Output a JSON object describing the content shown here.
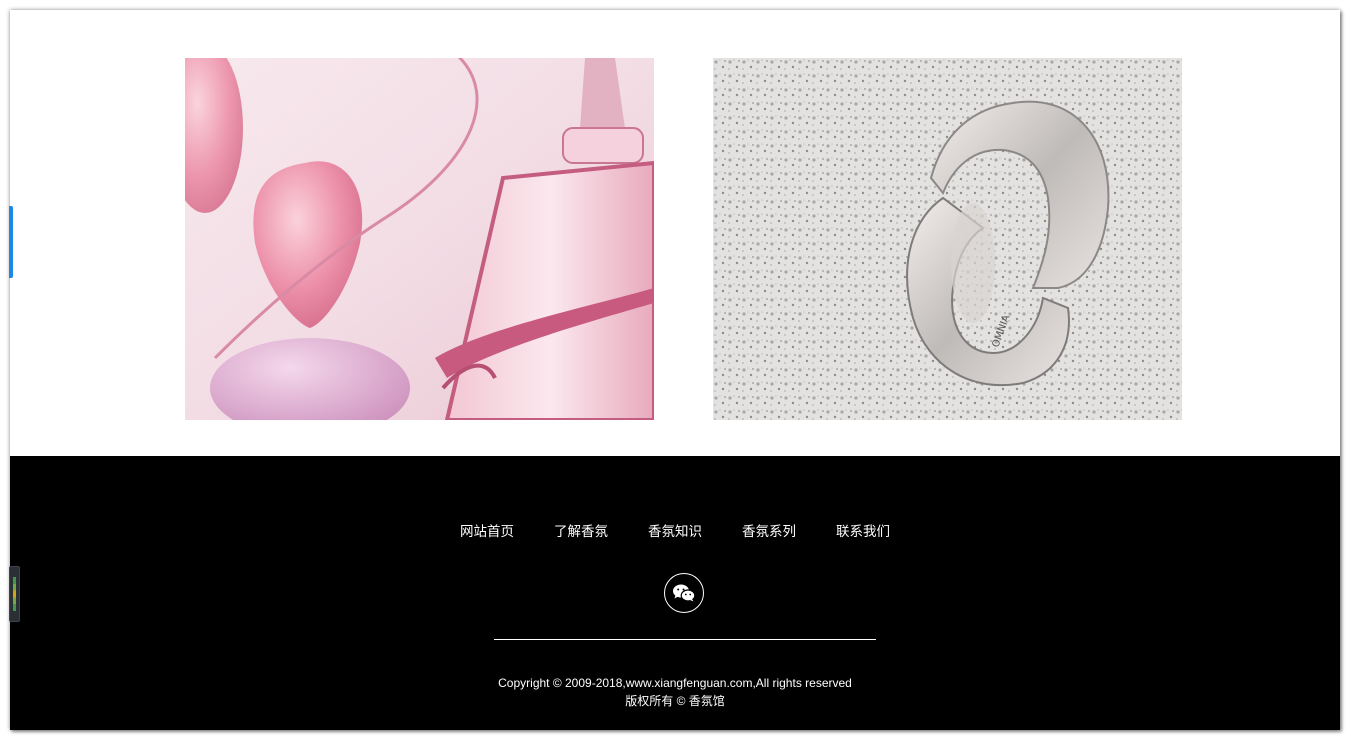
{
  "footer": {
    "nav": [
      {
        "label": "网站首页"
      },
      {
        "label": "了解香氛"
      },
      {
        "label": "香氛知识"
      },
      {
        "label": "香氛系列"
      },
      {
        "label": "联系我们"
      }
    ],
    "wechat_icon": "wechat-icon",
    "copyright_line1": "Copyright © 2009-2018,www.xiangfenguan.com,All rights reserved",
    "copyright_line2": "版权所有 © 香氛馆"
  },
  "colors": {
    "footer_bg": "#000000",
    "footer_text": "#ffffff",
    "edge_tab": "#1e88e5"
  }
}
